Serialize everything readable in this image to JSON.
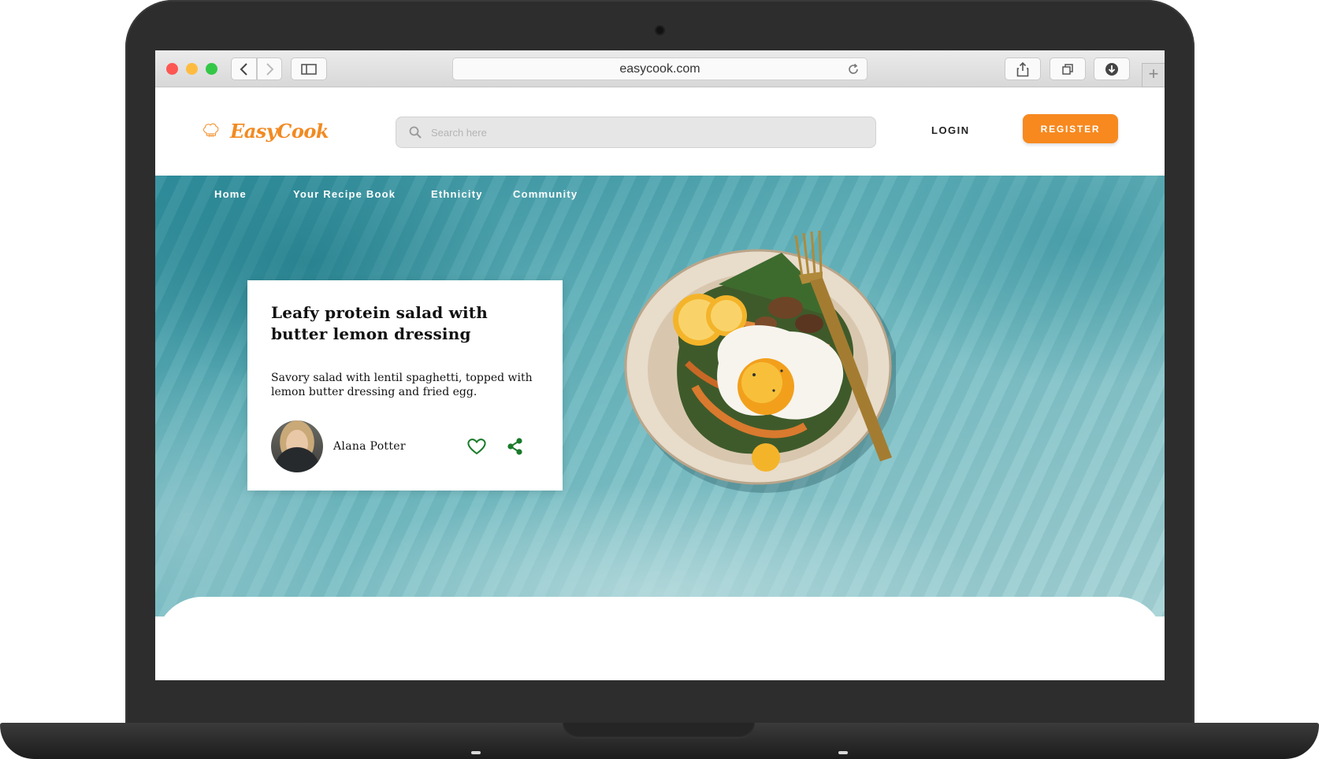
{
  "browser": {
    "url": "easycook.com"
  },
  "site": {
    "logo_text": "EasyCook",
    "search_placeholder": "Search here",
    "login_label": "LOGIN",
    "register_label": "REGISTER",
    "brand_color": "#f7891f"
  },
  "nav": {
    "items": [
      {
        "label": "Home"
      },
      {
        "label": "Your Recipe Book"
      },
      {
        "label": "Ethnicity"
      },
      {
        "label": "Community"
      }
    ]
  },
  "recipe_card": {
    "title": "Leafy protein salad with butter lemon dressing",
    "description": "Savory salad with lentil spaghetti, topped with lemon butter dressing and fried egg.",
    "author": "Alana Potter",
    "accent_color": "#1a7a2a"
  }
}
